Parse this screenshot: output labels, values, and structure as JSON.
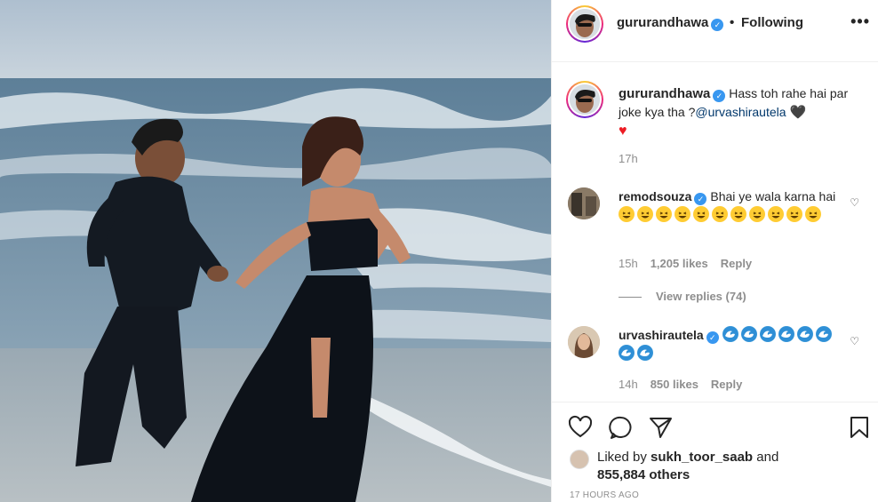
{
  "post": {
    "author": "gururandhawa",
    "follow_status": "Following",
    "more_icon": "more-horizontal-icon",
    "dot": "•"
  },
  "caption": {
    "username": "gururandhawa",
    "text": "Hass toh rahe hai par joke kya tha ?",
    "mention": "@urvashirautela",
    "emojis": [
      "black-heart",
      "red-heart"
    ],
    "time": "17h"
  },
  "comments": [
    {
      "username": "remodsouza",
      "verified": true,
      "text": "Bhai ye wala karna hai",
      "emoji": "laughing-face",
      "emoji_count": 11,
      "time": "15h",
      "likes": "1,205 likes",
      "reply": "Reply",
      "view_replies": "View replies (74)"
    },
    {
      "username": "urvashirautela",
      "verified": true,
      "text": "",
      "emoji": "water-wave",
      "emoji_count": 8,
      "time": "14h",
      "likes": "850 likes",
      "reply": "Reply"
    }
  ],
  "likes": {
    "prefix": "Liked by",
    "user": "sukh_toor_saab",
    "and": "and",
    "count": "855,884 others"
  },
  "posted_ago": "17 HOURS AGO",
  "colors": {
    "verified": "#3897f0",
    "mention": "#00376b",
    "muted": "#8e8e8e",
    "heart_red": "#ed1c24"
  }
}
